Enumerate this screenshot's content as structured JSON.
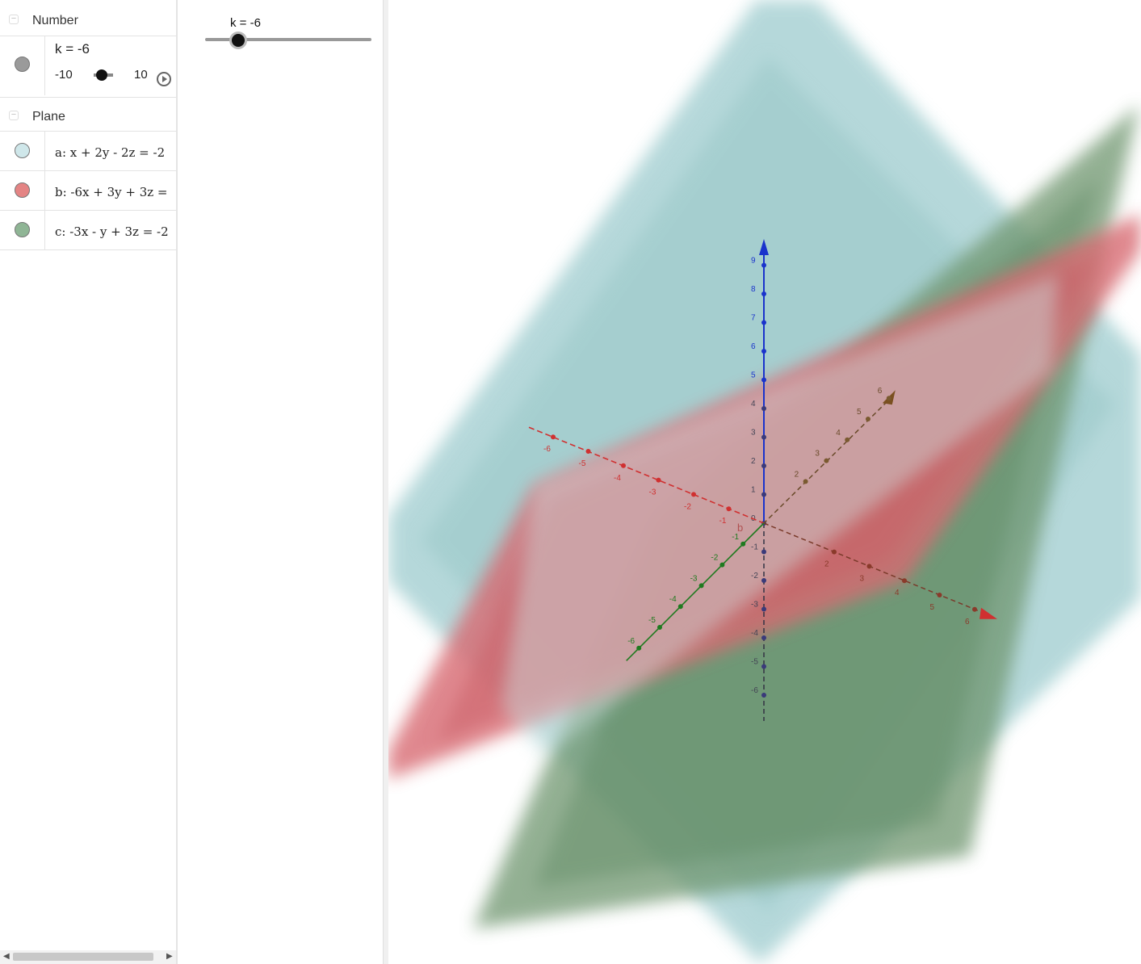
{
  "algebra": {
    "groups": [
      {
        "title": "Number"
      },
      {
        "title": "Plane"
      }
    ],
    "slider_item": {
      "expression": "k = -6",
      "min": "-10",
      "max": "10",
      "marble_color": "#9a9a9a"
    },
    "planes": [
      {
        "expression": "a: x + 2y - 2z = -2",
        "color": "#cfe7ea"
      },
      {
        "expression": "b: -6x + 3y + 3z =",
        "color": "#e48484"
      },
      {
        "expression": "c: -3x - y + 3z = -2",
        "color": "#8fb595"
      }
    ]
  },
  "graphics2d": {
    "slider_label": "k = -6",
    "value": -6,
    "min": -10,
    "max": 10
  },
  "view3d": {
    "z_ticks": [
      "9",
      "8",
      "7",
      "6",
      "5",
      "4",
      "3",
      "2",
      "1",
      "0",
      "-1",
      "-2",
      "-3",
      "-4",
      "-5",
      "-6"
    ],
    "x_ticks": [
      "-6",
      "-5",
      "-4",
      "-3",
      "-2",
      "-1",
      "2",
      "3",
      "4",
      "5",
      "6"
    ],
    "y_ticks": [
      "-6",
      "-5",
      "-4",
      "-3",
      "-2",
      "-1",
      "2",
      "3",
      "4",
      "5",
      "6"
    ],
    "plane_label": "b",
    "axis_colors": {
      "x": "#d03030",
      "y": "#1f7a1f",
      "z": "#1a33cc"
    }
  }
}
